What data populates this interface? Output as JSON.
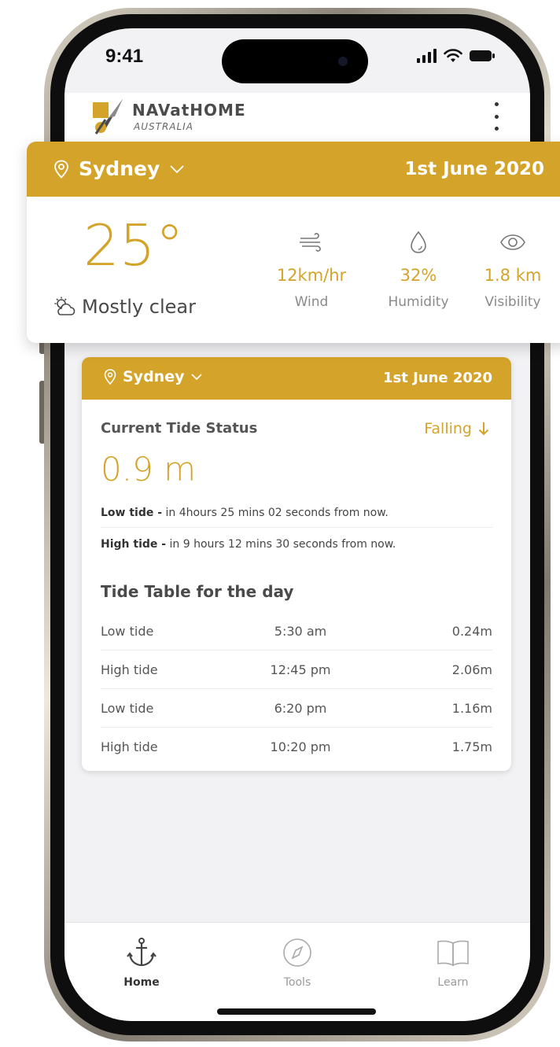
{
  "status_bar": {
    "time": "9:41"
  },
  "app": {
    "name": "NAVatHOME",
    "subtitle": "AUSTRALIA",
    "accent_color": "#d4a32a"
  },
  "weather": {
    "location": "Sydney",
    "date": "1st June 2020",
    "temperature": "25°",
    "condition": "Mostly clear",
    "metrics": [
      {
        "icon": "wind-icon",
        "value": "12km/hr",
        "label": "Wind"
      },
      {
        "icon": "humidity-drop-icon",
        "value": "32%",
        "label": "Humidity"
      },
      {
        "icon": "eye-icon",
        "value": "1.8 km",
        "label": "Visibility"
      }
    ]
  },
  "tide": {
    "location": "Sydney",
    "date": "1st June 2020",
    "status_label": "Current Tide Status",
    "direction": "Falling",
    "current_level": "0.9 m",
    "next": [
      {
        "type": "Low tide -",
        "detail": " in 4hours 25 mins 02 seconds from now."
      },
      {
        "type": "High tide -",
        "detail": " in 9 hours 12 mins 30 seconds from now."
      }
    ],
    "table_title": "Tide Table for the day",
    "table": [
      {
        "type": "Low tide",
        "time": "5:30 am",
        "height": "0.24m"
      },
      {
        "type": "High tide",
        "time": "12:45 pm",
        "height": "2.06m"
      },
      {
        "type": "Low tide",
        "time": "6:20 pm",
        "height": "1.16m"
      },
      {
        "type": "High tide",
        "time": "10:20 pm",
        "height": "1.75m"
      }
    ]
  },
  "tabs": [
    {
      "label": "Home",
      "icon": "anchor-icon",
      "active": true
    },
    {
      "label": "Tools",
      "icon": "compass-icon",
      "active": false
    },
    {
      "label": "Learn",
      "icon": "book-icon",
      "active": false
    }
  ]
}
